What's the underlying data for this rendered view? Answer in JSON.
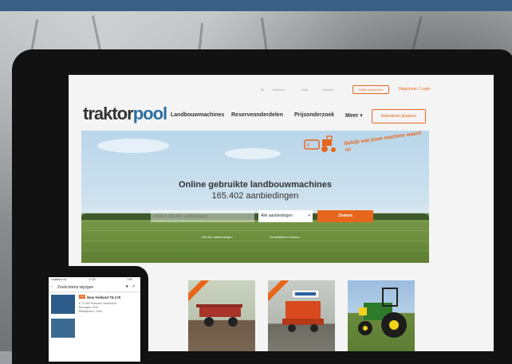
{
  "site": {
    "logo": {
      "part1": "traktor",
      "part2": "pool"
    },
    "utility": {
      "items": [
        "Tel",
        "Beheren",
        "Help",
        "Contact"
      ],
      "advertise_link": "Gratis adverteren",
      "login": "Registreer / Login"
    },
    "nav": {
      "items": [
        "Landbouwmachines",
        "Reserveonderdelen",
        "Prijsonderzoek",
        "Meer"
      ],
      "advertise_button": "Adverteren plaatsen"
    },
    "hero": {
      "title": "Online gebruikte landbouwmachines",
      "count": "165.402 aanbiedingen",
      "search_placeholder": "Zoek in 165.402 aanbiedingen",
      "category_selected": "Alle aanbiedingen",
      "search_button": "Zoeken",
      "links": [
        "165.402 aanbiedingen",
        "Gedetailleerd zoeken"
      ],
      "badge_text": "Bekijk wat jouw machine waard is!"
    },
    "cards": [
      "card-1",
      "card-2",
      "card-3",
      "card-4"
    ]
  },
  "phone": {
    "status": {
      "carrier": "vodafone NL",
      "time": "17:32",
      "battery": "74%"
    },
    "header": "Zoekcriteria wijzigen",
    "listing": {
      "badge": "TOP",
      "title": "New Holland T6.175",
      "lines": [
        "€ 70.000 Exclusief, Nederland",
        "Bouwjaar: 2016",
        "Bedrijfsuren: 3.542"
      ]
    }
  },
  "colors": {
    "accent": "#e8661c",
    "brand_blue": "#2b6e9e",
    "frame": "#121212"
  }
}
